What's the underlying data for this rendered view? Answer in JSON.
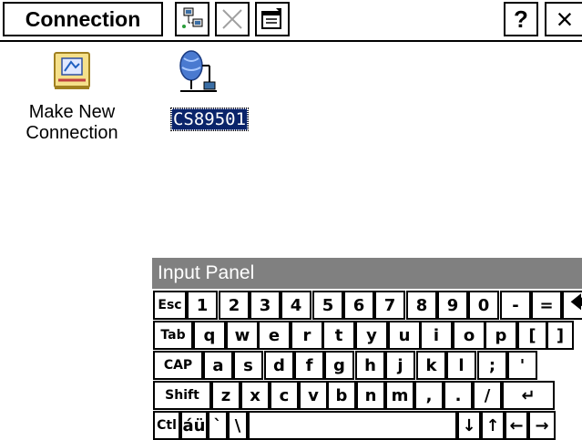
{
  "toolbar": {
    "title": "Connection",
    "help_label": "?",
    "close_label": "×"
  },
  "desktop": {
    "items": [
      {
        "label_line1": "Make New",
        "label_line2": "Connection",
        "icon": "make-new-connection-icon"
      },
      {
        "label": "CS89501",
        "icon": "network-connection-icon",
        "selected": true
      }
    ]
  },
  "input_panel": {
    "title": "Input Panel",
    "rows": [
      [
        "Esc",
        "1",
        "2",
        "3",
        "4",
        "5",
        "6",
        "7",
        "8",
        "9",
        "0",
        "-",
        "=",
        "🡄"
      ],
      [
        "Tab",
        "q",
        "w",
        "e",
        "r",
        "t",
        "y",
        "u",
        "i",
        "o",
        "p",
        "[",
        "]"
      ],
      [
        "CAP",
        "a",
        "s",
        "d",
        "f",
        "g",
        "h",
        "j",
        "k",
        "l",
        ";",
        "'"
      ],
      [
        "Shift",
        "z",
        "x",
        "c",
        "v",
        "b",
        "n",
        "m",
        ",",
        ".",
        "/",
        "↵"
      ],
      [
        "Ctl",
        "áü",
        "`",
        "\\",
        "",
        "↓",
        "↑",
        "←",
        "→"
      ]
    ]
  }
}
